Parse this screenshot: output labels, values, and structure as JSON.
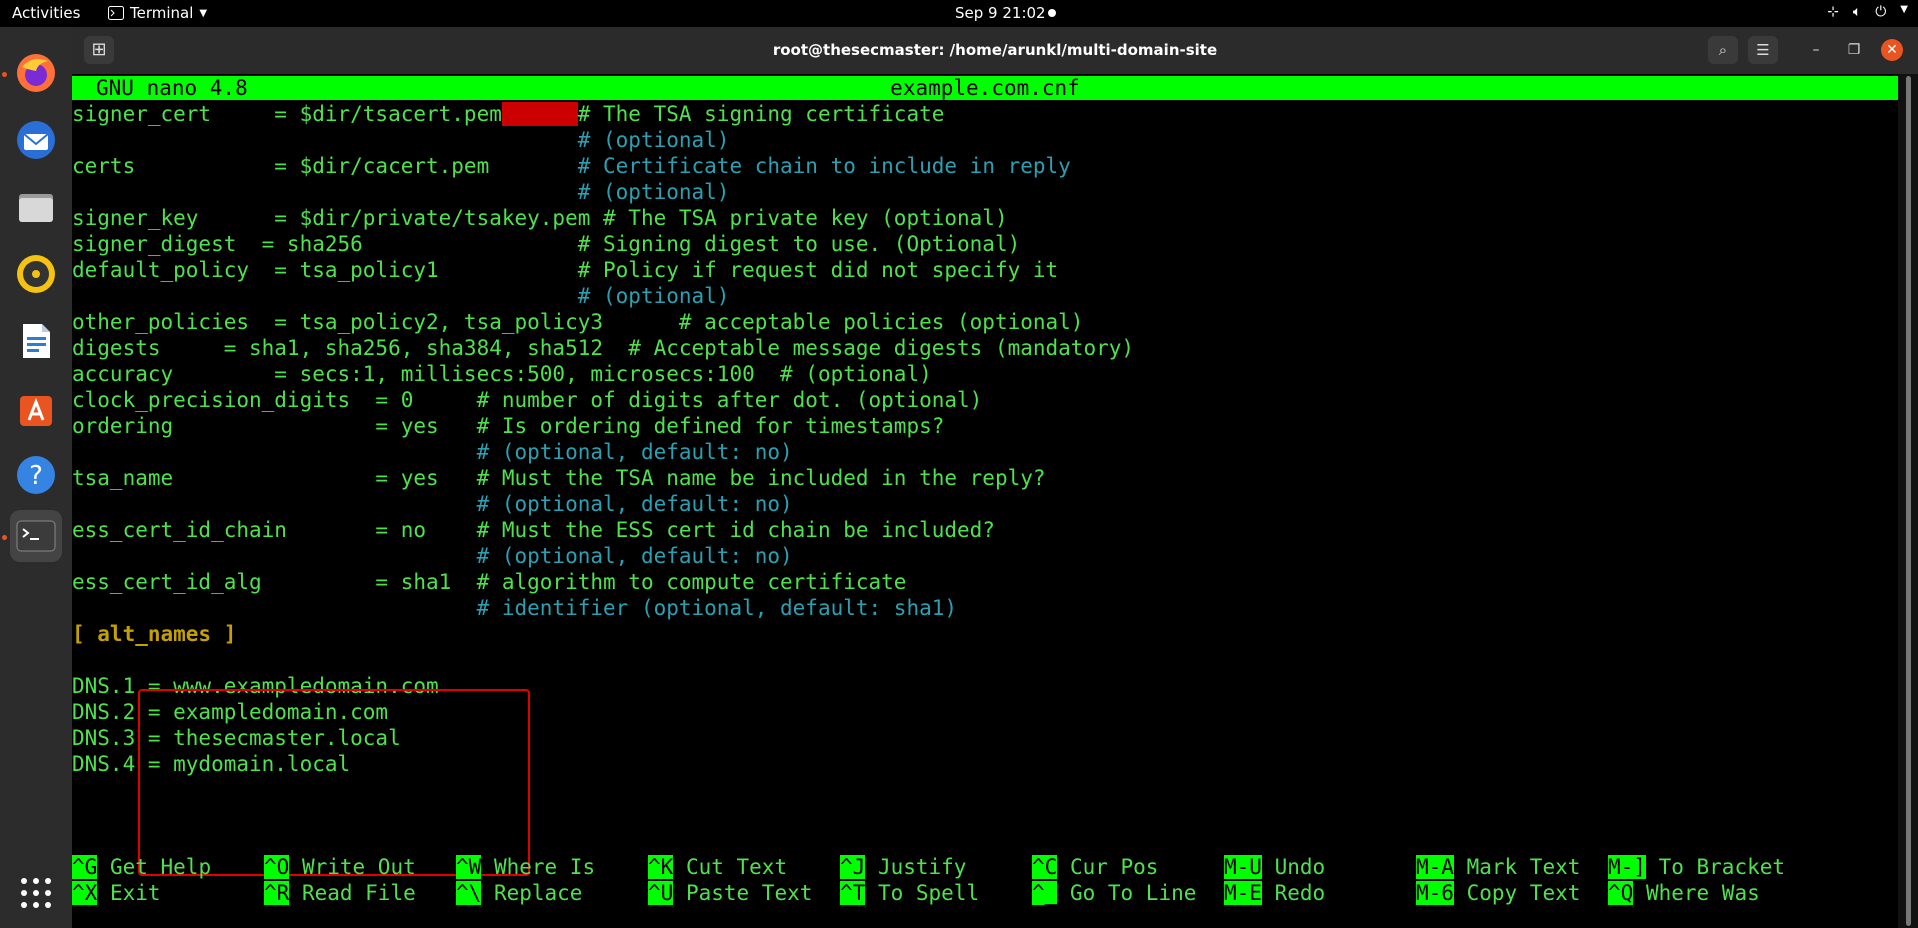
{
  "topbar": {
    "activities": "Activities",
    "app_name": "Terminal",
    "clock": "Sep 9  21:02"
  },
  "window": {
    "title": "root@thesecmaster: /home/arunkl/multi-domain-site"
  },
  "nano": {
    "version": "GNU nano 4.8",
    "filename": "example.com.cnf"
  },
  "lines": [
    {
      "text": "signer_cert     = $dir/tsacert.pem",
      "hl": "      ",
      "comment": "# The TSA signing certificate"
    },
    {
      "text": "                                        ",
      "comment": "# (optional)"
    },
    {
      "text": "certs           = $dir/cacert.pem       ",
      "comment": "# Certificate chain to include in reply"
    },
    {
      "text": "                                        ",
      "comment": "# (optional)"
    },
    {
      "text": "signer_key      = $dir/private/tsakey.pem # The TSA private key (optional)"
    },
    {
      "text": "signer_digest  = sha256                 # Signing digest to use. (Optional)"
    },
    {
      "text": "default_policy  = tsa_policy1           # Policy if request did not specify it"
    },
    {
      "text": "                                        ",
      "comment": "# (optional)"
    },
    {
      "text": "other_policies  = tsa_policy2, tsa_policy3      # acceptable policies (optional)"
    },
    {
      "text": "digests     = sha1, sha256, sha384, sha512  # Acceptable message digests (mandatory)"
    },
    {
      "text": "accuracy        = secs:1, millisecs:500, microsecs:100  # (optional)"
    },
    {
      "text": "clock_precision_digits  = 0     # number of digits after dot. (optional)"
    },
    {
      "text": "ordering                = yes   # Is ordering defined for timestamps?"
    },
    {
      "text": "                                ",
      "comment": "# (optional, default: no)"
    },
    {
      "text": "tsa_name                = yes   # Must the TSA name be included in the reply?"
    },
    {
      "text": "                                ",
      "comment": "# (optional, default: no)"
    },
    {
      "text": "ess_cert_id_chain       = no    # Must the ESS cert id chain be included?"
    },
    {
      "text": "                                ",
      "comment": "# (optional, default: no)"
    },
    {
      "text": "ess_cert_id_alg         = sha1  # algorithm to compute certificate"
    },
    {
      "text": "                                ",
      "comment": "# identifier (optional, default: sha1)"
    },
    {
      "text": "[ alt_names ]",
      "section": true
    },
    {
      "text": ""
    },
    {
      "text": "DNS.1 = www.exampledomain.com"
    },
    {
      "text": "DNS.2 = exampledomain.com"
    },
    {
      "text": "DNS.3 = thesecmaster.local"
    },
    {
      "text": "DNS.4 = mydomain.local"
    }
  ],
  "shortcuts": [
    [
      {
        "key": "^G",
        "label": "Get Help"
      },
      {
        "key": "^X",
        "label": "Exit"
      }
    ],
    [
      {
        "key": "^O",
        "label": "Write Out"
      },
      {
        "key": "^R",
        "label": "Read File"
      }
    ],
    [
      {
        "key": "^W",
        "label": "Where Is"
      },
      {
        "key": "^\\",
        "label": "Replace"
      }
    ],
    [
      {
        "key": "^K",
        "label": "Cut Text"
      },
      {
        "key": "^U",
        "label": "Paste Text"
      }
    ],
    [
      {
        "key": "^J",
        "label": "Justify"
      },
      {
        "key": "^T",
        "label": "To Spell"
      }
    ],
    [
      {
        "key": "^C",
        "label": "Cur Pos"
      },
      {
        "key": "^_",
        "label": "Go To Line"
      }
    ],
    [
      {
        "key": "M-U",
        "label": "Undo"
      },
      {
        "key": "M-E",
        "label": "Redo"
      }
    ],
    [
      {
        "key": "M-A",
        "label": "Mark Text"
      },
      {
        "key": "M-6",
        "label": "Copy Text"
      }
    ],
    [
      {
        "key": "M-]",
        "label": "To Bracket"
      },
      {
        "key": "^Q",
        "label": "Where Was"
      }
    ]
  ],
  "dock_items": [
    {
      "name": "firefox-icon",
      "color": "#ff7139"
    },
    {
      "name": "thunderbird-icon",
      "color": "#2a6fd6"
    },
    {
      "name": "files-icon",
      "color": "#bdbdbd"
    },
    {
      "name": "rhythmbox-icon",
      "color": "#f5c211"
    },
    {
      "name": "libreoffice-writer-icon",
      "color": "#2a7fd4"
    },
    {
      "name": "ubuntu-software-icon",
      "color": "#e95420"
    },
    {
      "name": "help-icon",
      "color": "#3584e4"
    },
    {
      "name": "terminal-icon",
      "color": "#3b3b3b"
    }
  ]
}
